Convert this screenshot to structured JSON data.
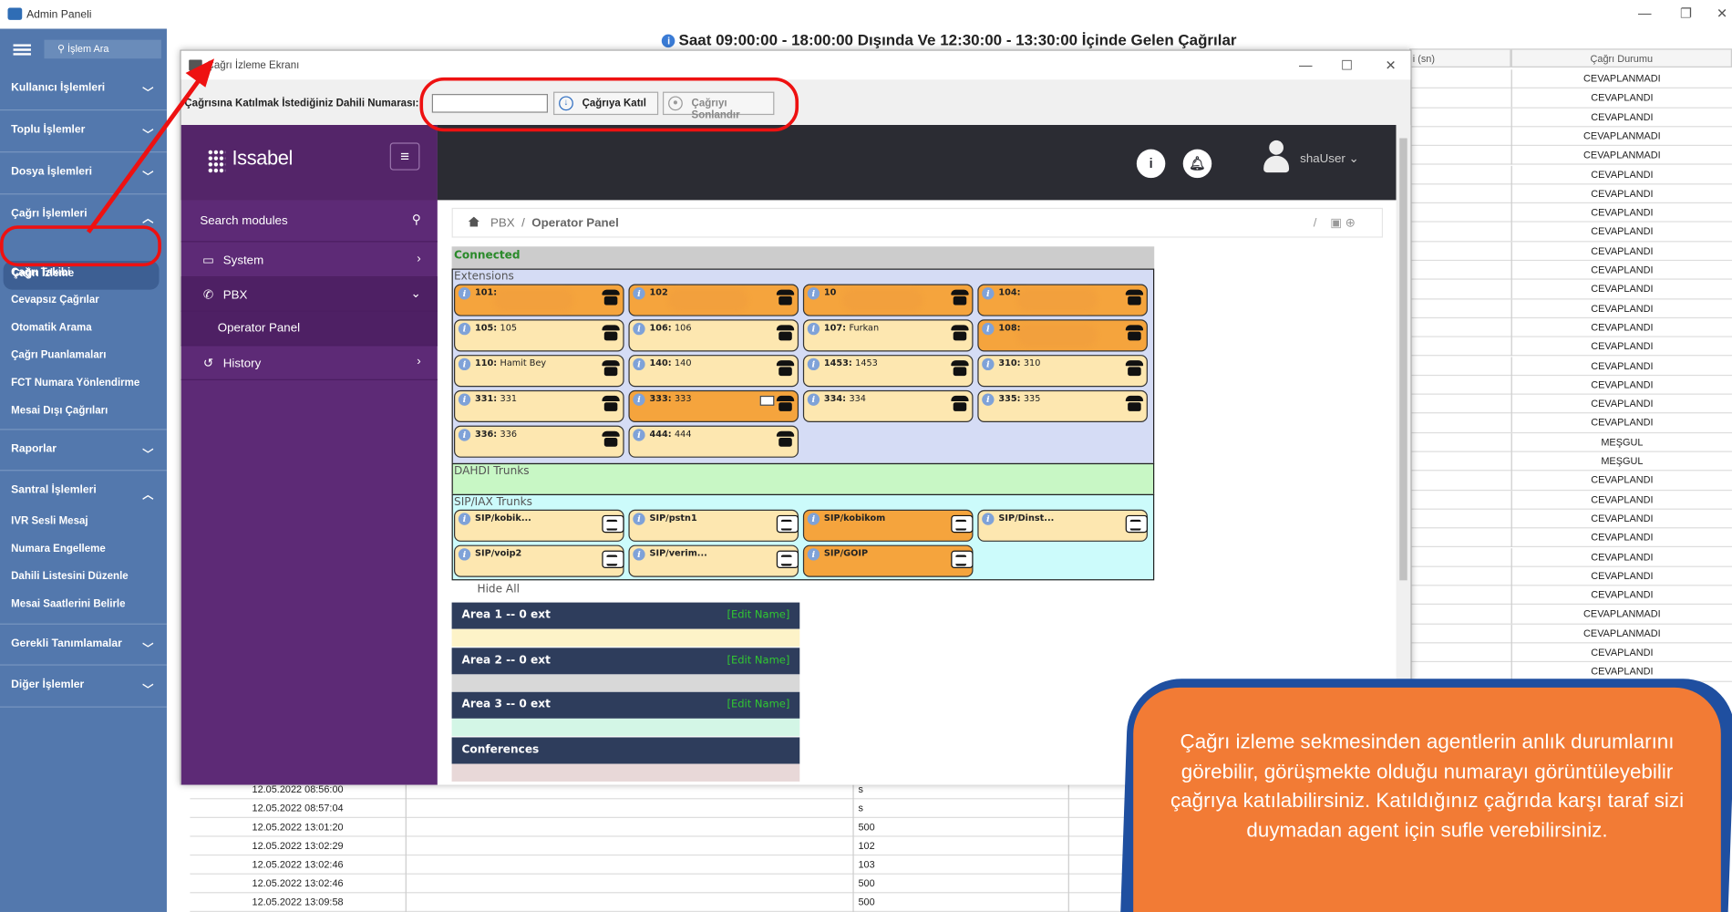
{
  "window": {
    "title": "Admin Paneli",
    "controls": [
      "—",
      "❐",
      "✕"
    ]
  },
  "sidebar": {
    "search_label": "İşlem Ara",
    "sections": [
      {
        "label": "Kullanıcı İşlemleri",
        "state": "collapsed"
      },
      {
        "label": "Toplu İşlemler",
        "state": "collapsed"
      },
      {
        "label": "Dosya İşlemleri",
        "state": "collapsed"
      },
      {
        "label": "Çağrı İşlemleri",
        "state": "expanded"
      },
      {
        "label": "Raporlar",
        "state": "collapsed"
      },
      {
        "label": "Santral İşlemleri",
        "state": "expanded"
      },
      {
        "label": "Gerekli Tanımlamalar",
        "state": "collapsed"
      },
      {
        "label": "Diğer İşlemler",
        "state": "collapsed"
      }
    ],
    "cagri_items": [
      "Çağrı İzleme",
      "Çağrı Takibi",
      "Cevapsız Çağrılar",
      "Otomatik Arama",
      "Çağrı Puanlamaları",
      "FCT Numara Yönlendirme",
      "Mesai Dışı Çağrıları"
    ],
    "santral_items": [
      "IVR Sesli Mesaj",
      "Numara Engelleme",
      "Dahili Listesini Düzenle",
      "Mesai Saatlerini Belirle"
    ]
  },
  "report": {
    "header": "Saat 09:00:00 - 18:00:00 Dışında Ve 12:30:00 - 13:30:00 İçinde Gelen Çağrılar",
    "col_duration": "i (sn)",
    "col_status": "Çağrı Durumu",
    "statuses": [
      "CEVAPLANMADI",
      "CEVAPLANDI",
      "CEVAPLANDI",
      "CEVAPLANMADI",
      "CEVAPLANMADI",
      "CEVAPLANDI",
      "CEVAPLANDI",
      "CEVAPLANDI",
      "CEVAPLANDI",
      "CEVAPLANDI",
      "CEVAPLANDI",
      "CEVAPLANDI",
      "CEVAPLANDI",
      "CEVAPLANDI",
      "CEVAPLANDI",
      "CEVAPLANDI",
      "CEVAPLANDI",
      "CEVAPLANDI",
      "CEVAPLANDI",
      "MEŞGUL",
      "MEŞGUL",
      "CEVAPLANDI",
      "CEVAPLANDI",
      "CEVAPLANDI",
      "CEVAPLANDI",
      "CEVAPLANDI",
      "CEVAPLANDI",
      "CEVAPLANDI",
      "CEVAPLANMADI",
      "CEVAPLANMADI",
      "CEVAPLANDI",
      "CEVAPLANDI"
    ],
    "bottom_rows": [
      {
        "date": "12.05.2022 08:56:00",
        "num": "s"
      },
      {
        "date": "12.05.2022 08:57:04",
        "num": "s"
      },
      {
        "date": "12.05.2022 13:01:20",
        "num": "500"
      },
      {
        "date": "12.05.2022 13:02:29",
        "num": "102"
      },
      {
        "date": "12.05.2022 13:02:46",
        "num": "103"
      },
      {
        "date": "12.05.2022 13:02:46",
        "num": "500"
      },
      {
        "date": "12.05.2022 13:09:58",
        "num": "500"
      }
    ]
  },
  "dialog": {
    "title": "Çağrı İzleme Ekranı",
    "join_label": "Çağrısına Katılmak İstediğiniz Dahili Numarası:",
    "join_value": "",
    "join_button": "Çağrıya Katıl",
    "end_button": "Çağrıyı Sonlandır"
  },
  "issabel": {
    "brand": "Issabel",
    "search": "Search modules",
    "modules": [
      {
        "label": "System",
        "icon": "laptop-icon"
      },
      {
        "label": "PBX",
        "icon": "phone-icon"
      },
      {
        "label": "Operator Panel",
        "icon": ""
      },
      {
        "label": "History",
        "icon": "history-icon"
      }
    ],
    "user": "shaUser",
    "crumb_root": "PBX",
    "crumb_page": "Operator Panel",
    "crumb_sep": "/"
  },
  "panel": {
    "status": "Connected",
    "extensions_label": "Extensions",
    "extensions": [
      {
        "num": "101:",
        "name": "",
        "busy": true
      },
      {
        "num": "102",
        "name": "",
        "busy": true
      },
      {
        "num": "10",
        "name": "",
        "busy": true
      },
      {
        "num": "104:",
        "name": "",
        "busy": true
      },
      {
        "num": "105:",
        "name": "105",
        "busy": false
      },
      {
        "num": "106:",
        "name": "106",
        "busy": false
      },
      {
        "num": "107:",
        "name": "Furkan",
        "busy": false
      },
      {
        "num": "108:",
        "name": "",
        "busy": true
      },
      {
        "num": "110:",
        "name": "Hamit Bey",
        "busy": false
      },
      {
        "num": "140:",
        "name": "140",
        "busy": false
      },
      {
        "num": "1453:",
        "name": "1453",
        "busy": false
      },
      {
        "num": "310:",
        "name": "310",
        "busy": false
      },
      {
        "num": "331:",
        "name": "331",
        "busy": false
      },
      {
        "num": "333:",
        "name": "333",
        "busy": true,
        "mail": true
      },
      {
        "num": "334:",
        "name": "334",
        "busy": false
      },
      {
        "num": "335:",
        "name": "335",
        "busy": false
      },
      {
        "num": "336:",
        "name": "336",
        "busy": false
      },
      {
        "num": "444:",
        "name": "444",
        "busy": false
      }
    ],
    "dahdi_label": "DAHDI Trunks",
    "sip_label": "SIP/IAX Trunks",
    "trunks": [
      {
        "name": "SIP/kobik...",
        "busy": false
      },
      {
        "name": "SIP/pstn1",
        "busy": false
      },
      {
        "name": "SIP/kobikom",
        "busy": true
      },
      {
        "name": "SIP/Dinst...",
        "busy": false
      },
      {
        "name": "SIP/voip2",
        "busy": false
      },
      {
        "name": "SIP/verim...",
        "busy": false
      },
      {
        "name": "SIP/GOIP",
        "busy": true
      }
    ],
    "hide_all": "Hide All",
    "areas": [
      {
        "label": "Area 1 -- 0 ext",
        "edit": "[Edit Name]",
        "color": "#fdf3c8"
      },
      {
        "label": "Area 2 -- 0 ext",
        "edit": "[Edit Name]",
        "color": "#d8d8d8"
      },
      {
        "label": "Area 3 -- 0 ext",
        "edit": "[Edit Name]",
        "color": "#d3f6e6"
      },
      {
        "label": "Conferences",
        "edit": "",
        "color": "#e8d8d8"
      }
    ]
  },
  "callout": {
    "text": "Çağrı izleme sekmesinden agentlerin anlık durumlarını görebilir, görüşmekte olduğu numarayı görüntüleyebilir çağrıya katılabilirsiniz. Katıldığınız çağrıda karşı taraf sizi duymadan agent için sufle verebilirsiniz."
  },
  "colors": {
    "sidebar": "#5378ad",
    "issabel_purple": "#5d2a76",
    "busy": "#f5a43d",
    "idle": "#fde7b0",
    "annotation_red": "#e11111",
    "callout_orange": "#f27b35",
    "callout_blue": "#1f4fa0"
  }
}
